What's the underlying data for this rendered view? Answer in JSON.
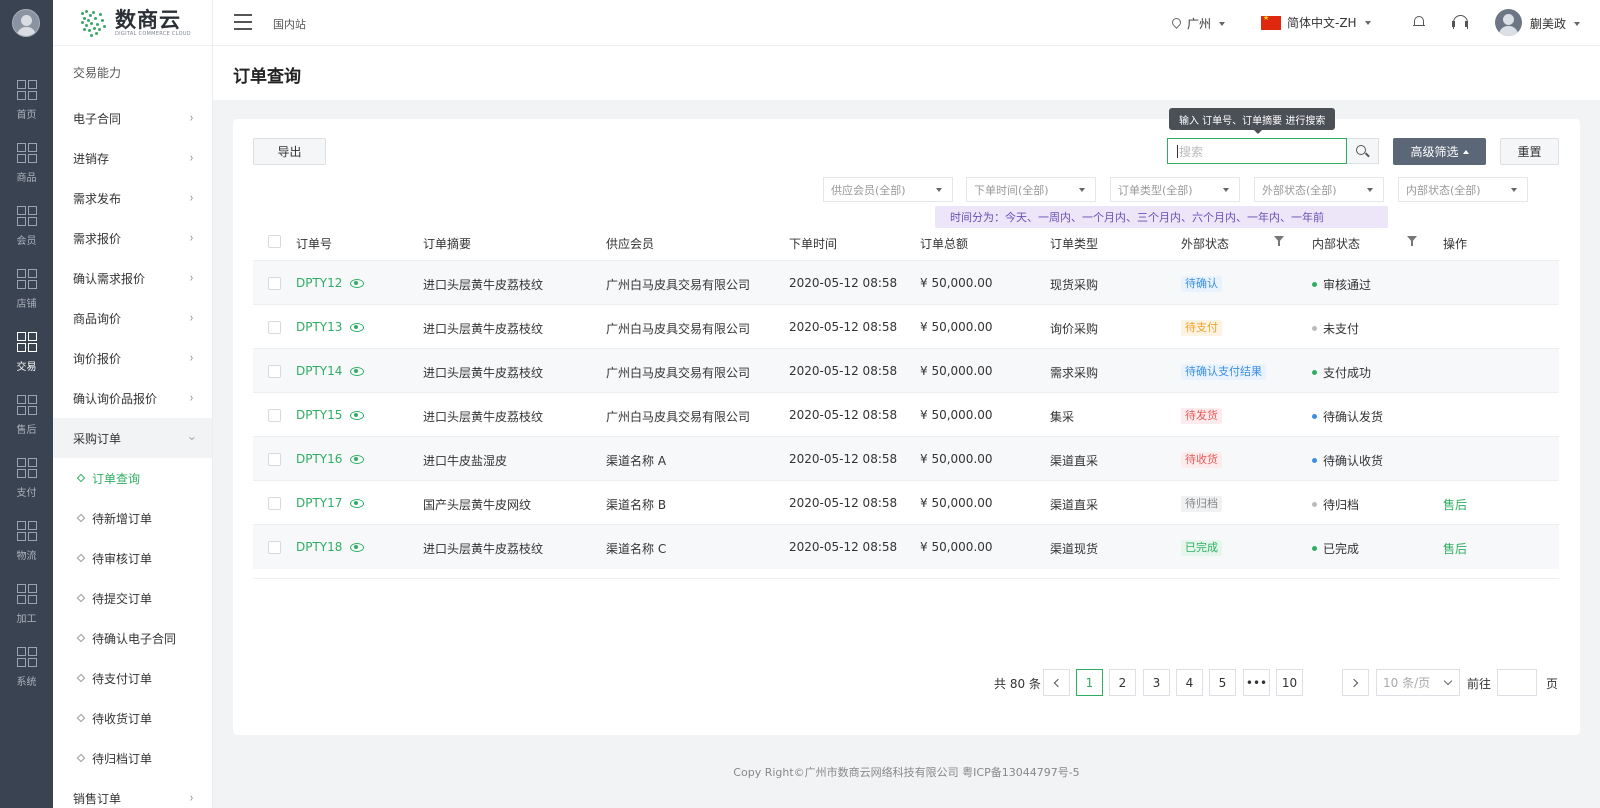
{
  "rail": {
    "items": [
      {
        "label": "首页"
      },
      {
        "label": "商品"
      },
      {
        "label": "会员"
      },
      {
        "label": "店铺"
      },
      {
        "label": "交易",
        "active": true
      },
      {
        "label": "售后"
      },
      {
        "label": "支付"
      },
      {
        "label": "物流"
      },
      {
        "label": "加工"
      },
      {
        "label": "系统"
      }
    ]
  },
  "brand": {
    "name": "数商云",
    "tagline": "DIGITAL COMMERCE CLOUD"
  },
  "subnav": {
    "section": "交易能力",
    "items": [
      {
        "label": "电子合同"
      },
      {
        "label": "进销存"
      },
      {
        "label": "需求发布"
      },
      {
        "label": "需求报价"
      },
      {
        "label": "确认需求报价"
      },
      {
        "label": "商品询价"
      },
      {
        "label": "询价报价"
      },
      {
        "label": "确认询价品报价"
      }
    ],
    "open_item": {
      "label": "采购订单"
    },
    "sub_items": [
      {
        "label": "订单查询",
        "active": true
      },
      {
        "label": "待新增订单"
      },
      {
        "label": "待审核订单"
      },
      {
        "label": "待提交订单"
      },
      {
        "label": "待确认电子合同"
      },
      {
        "label": "待支付订单"
      },
      {
        "label": "待收货订单"
      },
      {
        "label": "待归档订单"
      }
    ],
    "last_item": {
      "label": "销售订单"
    }
  },
  "header": {
    "site": "国内站",
    "city": "广州",
    "language": "简体中文-ZH",
    "user_name": "蒯美政"
  },
  "page": {
    "title": "订单查询"
  },
  "toolbar": {
    "export_label": "导出",
    "search_placeholder": "搜索",
    "search_tooltip": "输入 订单号、订单摘要 进行搜索",
    "advanced_label": "高级筛选",
    "reset_label": "重置"
  },
  "filters": [
    "供应会员(全部)",
    "下单时间(全部)",
    "订单类型(全部)",
    "外部状态(全部)",
    "内部状态(全部)"
  ],
  "time_hint": "时间分为：今天、一周内、一个月内、三个月内、六个月内、一年内、一年前",
  "table": {
    "columns": [
      "订单号",
      "订单摘要",
      "供应会员",
      "下单时间",
      "订单总额",
      "订单类型",
      "外部状态",
      "内部状态",
      "操作"
    ],
    "rows": [
      {
        "order_no": "DPTY12",
        "summary": "进口头层黄牛皮荔枝纹",
        "supplier": "广州白马皮具交易有限公司",
        "time": "2020-05-12 08:58",
        "amount": "¥ 50,000.00",
        "type": "现货采购",
        "ext_status": "待确认",
        "ext_color": "blue",
        "int_status": "审核通过",
        "int_dot": "#2fae63",
        "action": ""
      },
      {
        "order_no": "DPTY13",
        "summary": "进口头层黄牛皮荔枝纹",
        "supplier": "广州白马皮具交易有限公司",
        "time": "2020-05-12 08:58",
        "amount": "¥ 50,000.00",
        "type": "询价采购",
        "ext_status": "待支付",
        "ext_color": "orange",
        "int_status": "未支付",
        "int_dot": "#bbbbbb",
        "action": ""
      },
      {
        "order_no": "DPTY14",
        "summary": "进口头层黄牛皮荔枝纹",
        "supplier": "广州白马皮具交易有限公司",
        "time": "2020-05-12 08:58",
        "amount": "¥ 50,000.00",
        "type": "需求采购",
        "ext_status": "待确认支付结果",
        "ext_color": "blue",
        "int_status": "支付成功",
        "int_dot": "#2fae63",
        "action": ""
      },
      {
        "order_no": "DPTY15",
        "summary": "进口头层黄牛皮荔枝纹",
        "supplier": "广州白马皮具交易有限公司",
        "time": "2020-05-12 08:58",
        "amount": "¥ 50,000.00",
        "type": "集采",
        "ext_status": "待发货",
        "ext_color": "red",
        "int_status": "待确认发货",
        "int_dot": "#3a8ee6",
        "action": ""
      },
      {
        "order_no": "DPTY16",
        "summary": "进口牛皮盐湿皮",
        "supplier": "渠道名称 A",
        "time": "2020-05-12 08:58",
        "amount": "¥ 50,000.00",
        "type": "渠道直采",
        "ext_status": "待收货",
        "ext_color": "red",
        "int_status": "待确认收货",
        "int_dot": "#3a8ee6",
        "action": ""
      },
      {
        "order_no": "DPTY17",
        "summary": "国产头层黄牛皮网纹",
        "supplier": "渠道名称 B",
        "time": "2020-05-12 08:58",
        "amount": "¥ 50,000.00",
        "type": "渠道直采",
        "ext_status": "待归档",
        "ext_color": "gray",
        "int_status": "待归档",
        "int_dot": "#bbbbbb",
        "action": "售后"
      },
      {
        "order_no": "DPTY18",
        "summary": "进口头层黄牛皮荔枝纹",
        "supplier": "渠道名称 C",
        "time": "2020-05-12 08:58",
        "amount": "¥ 50,000.00",
        "type": "渠道现货",
        "ext_status": "已完成",
        "ext_color": "green",
        "int_status": "已完成",
        "int_dot": "#2fae63",
        "action": "售后"
      }
    ]
  },
  "pagination": {
    "total": "共 80 条",
    "pages": [
      "1",
      "2",
      "3",
      "4",
      "5",
      "•••",
      "10"
    ],
    "current": "1",
    "page_size": "10 条/页",
    "goto_label": "前往",
    "page_suffix": "页"
  },
  "footer": {
    "text": "Copy Right©广州市数商云网络科技有限公司 粤ICP备13044797号-5"
  },
  "colors": {
    "accent": "#2fae63",
    "rail_bg": "#3a4351",
    "advanced_btn": "#5b6676",
    "hint_bg": "#ece6f8",
    "hint_text": "#6b4fb7"
  }
}
